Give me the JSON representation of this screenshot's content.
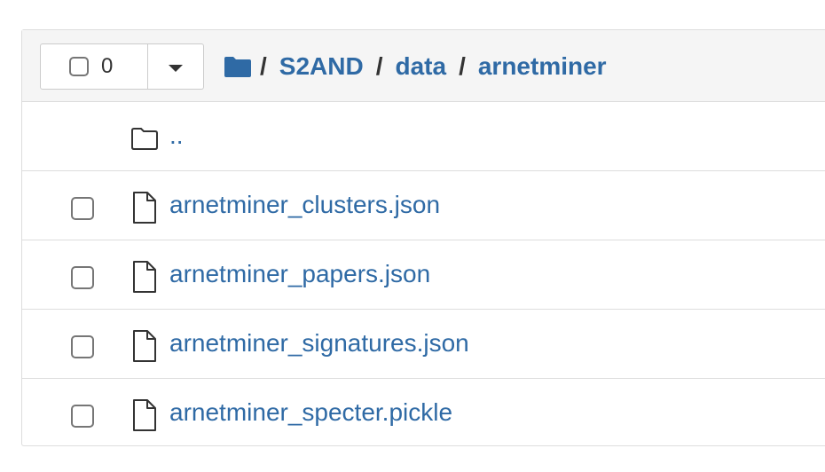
{
  "toolbar": {
    "selected_count": "0",
    "dropdown_icon": "caret-down-icon"
  },
  "breadcrumb": {
    "root_icon": "folder-icon",
    "separator": "/",
    "items": [
      {
        "label": "S2AND"
      },
      {
        "label": "data"
      },
      {
        "label": "arnetminer"
      }
    ]
  },
  "listing": {
    "parent": {
      "label": "..",
      "icon": "folder-outline-icon"
    },
    "files": [
      {
        "name": "arnetminer_clusters.json",
        "icon": "file-icon"
      },
      {
        "name": "arnetminer_papers.json",
        "icon": "file-icon"
      },
      {
        "name": "arnetminer_signatures.json",
        "icon": "file-icon"
      },
      {
        "name": "arnetminer_specter.pickle",
        "icon": "file-icon"
      }
    ]
  },
  "colors": {
    "link": "#2f6aa5",
    "header_bg": "#f5f5f5",
    "border": "#dddddd"
  }
}
